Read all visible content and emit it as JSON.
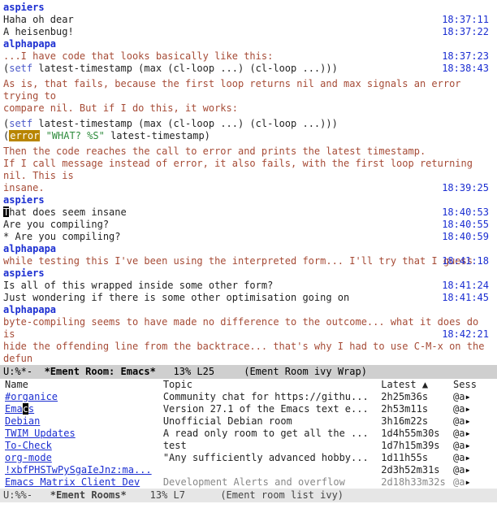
{
  "chat": {
    "nick1": "aspiers",
    "nick2": "alphapapa",
    "l1": "Haha oh dear",
    "l2": "A heisenbug!",
    "t1": "18:37:11",
    "t2": "18:37:22",
    "l3": "...I have code that looks basically like this:",
    "t3": "18:37:23",
    "code1_a": "(",
    "code1_fn": "setf",
    "code1_b": " latest-timestamp (max (cl-loop ...) (cl-loop ...)))",
    "t4": "18:38:43",
    "l4": "As is, that fails, because the first loop returns nil and max signals an error trying to",
    "l5": "compare nil. But if I do this, it works:",
    "code2_a": "(",
    "code2_fn": "setf",
    "code2_b": " latest-timestamp (max (cl-loop ...) (cl-loop ...)))",
    "code3_a": " (",
    "code3_err": "error",
    "code3_str": " \"WHAT? %S\"",
    "code3_b": " latest-timestamp)",
    "l6": "Then the code reaches the call to error and prints the latest timestamp.",
    "l7": "If I call message instead of error, it also fails, with the first loop returning nil. This is",
    "l8": "insane.",
    "t5": "18:39:25",
    "a1_first": "T",
    "a1_rest": "hat does seem insane",
    "a2": "Are you compiling?",
    "a3": " * Are you compiling?",
    "ta1": "18:40:53",
    "ta2": "18:40:55",
    "ta3": "18:40:59",
    "p1": "while testing this I've been using the interpreted form... I'll try that I guess",
    "tp1": "18:41:18",
    "a4": "Is all of this wrapped inside some other form?",
    "a5": "Just wondering if there is some other optimisation going on",
    "ta4": "18:41:24",
    "ta5": "18:41:45",
    "p2": "byte-compiling seems to have made no difference to the outcome... what it does do is",
    "p3": "hide the offending line from the backtrace... that's why I had to use C-M-x on the defun",
    "tp2": "18:42:21"
  },
  "modeline1": {
    "left": "U:%*-  ",
    "title": "*Ement Room: Emacs*",
    "right": "   13% L25     (Ement Room ivy Wrap)"
  },
  "rooms": {
    "hdr_name": "Name",
    "hdr_topic": "Topic",
    "hdr_latest": "Latest ▲",
    "hdr_sess": "Sess",
    "sess": "@a",
    "items": [
      {
        "name": "#organice",
        "topic": "Community chat for https://githu...",
        "latest": "2h25m36s"
      },
      {
        "name": "Emacs",
        "topic": "Version 27.1 of the Emacs text e...",
        "latest": "2h53m11s",
        "caretAt": 3
      },
      {
        "name": "Debian",
        "topic": "Unofficial Debian room",
        "latest": "3h16m22s"
      },
      {
        "name": "TWIM Updates",
        "topic": "A read only room to get all the ...",
        "latest": "1d4h55m30s"
      },
      {
        "name": "To-Check",
        "topic": "test",
        "latest": "1d7h15m39s"
      },
      {
        "name": "org-mode",
        "topic": "\"Any sufficiently advanced hobby...",
        "latest": "1d11h55s"
      },
      {
        "name": "!xbfPHSTwPySgaIeJnz:ma...",
        "topic": "",
        "latest": "2d3h52m31s"
      },
      {
        "name": "Emacs Matrix Client Dev",
        "topic": "Development Alerts and overflow",
        "latest": "2d18h33m32s",
        "dim": true
      }
    ]
  },
  "modeline2": {
    "left": "U:%%-   ",
    "title": "*Ement Rooms*",
    "right": "    13% L7      (Ement room list ivy)"
  }
}
